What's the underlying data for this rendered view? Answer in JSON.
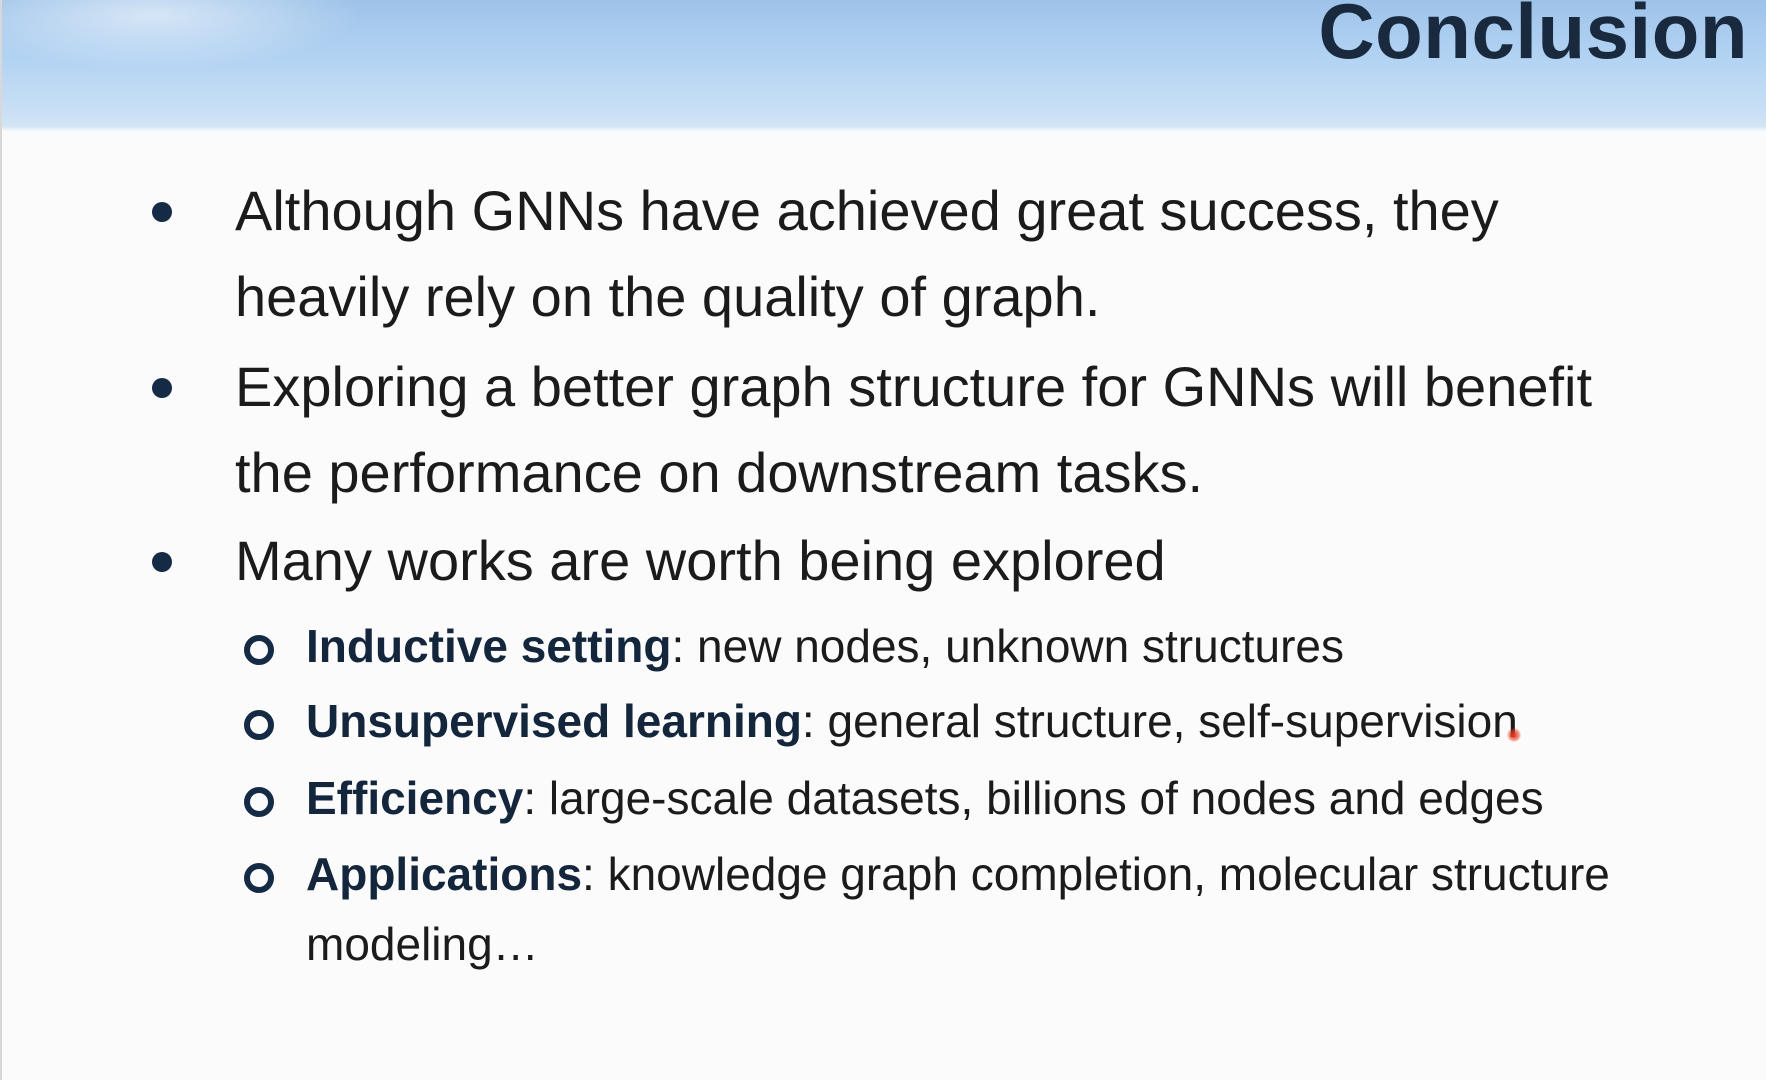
{
  "slide": {
    "title": "Conclusion",
    "bullets": [
      {
        "line1": "Although GNNs have achieved great success, they",
        "line2": "heavily rely on the quality of graph."
      },
      {
        "line1": "Exploring a better graph structure for GNNs will benefit",
        "line2": "the performance on downstream tasks."
      },
      {
        "line1": "Many works are worth being explored"
      }
    ],
    "subitems": [
      {
        "term": "Inductive setting",
        "desc": ": new nodes, unknown structures"
      },
      {
        "term": "Unsupervised learning",
        "desc": ": general structure, self-supervision"
      },
      {
        "term": "Efficiency",
        "desc": ": large-scale datasets, billions of nodes and edges"
      },
      {
        "term": "Applications",
        "desc": ": knowledge graph completion, molecular structure",
        "desc2": "modeling…"
      }
    ],
    "colors": {
      "header_blue": "#b3d3f3",
      "title_navy": "#1a2a3e",
      "bullet_navy": "#152a44",
      "laser_pointer": "#e63a1e"
    }
  }
}
